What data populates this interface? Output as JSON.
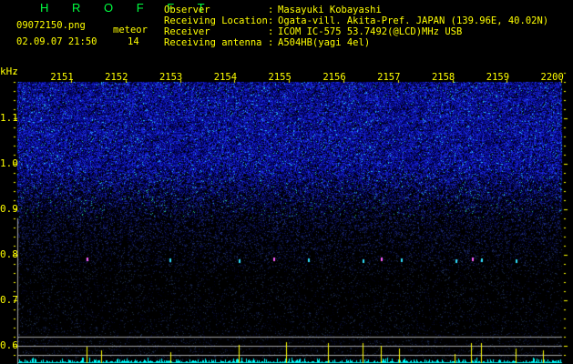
{
  "app": {
    "title": "H R O F F T"
  },
  "file": {
    "name": "09072150.png",
    "datetime": "02.09.07 21:50"
  },
  "meteor": {
    "label": "meteor",
    "count": "14"
  },
  "info": [
    {
      "label": "Observer",
      "value": "Masayuki Kobayashi"
    },
    {
      "label": "Receiving Location",
      "value": "Ogata-vill. Akita-Pref. JAPAN (139.96E, 40.02N)"
    },
    {
      "label": "Receiver",
      "value": "ICOM IC-575 53.7492(@LCD)MHz USB"
    },
    {
      "label": "Receiving antenna",
      "value": "A504HB(yagi 4el)"
    }
  ],
  "axis": {
    "y_unit": "kHz",
    "y_ticks": [
      "1.1",
      "1.0",
      "0.9",
      "0.8",
      "0.7",
      "0.6"
    ],
    "x_ticks": [
      "2151",
      "2152",
      "2153",
      "2154",
      "2155",
      "2156",
      "2157",
      "2158",
      "2159",
      "2200"
    ]
  },
  "colors": {
    "text": "#ffff00",
    "title": "#00ff40",
    "noise": "#2020ff",
    "histogram": "#00ffff",
    "spike": "#ffff00",
    "grid": "#a0a0a0"
  }
}
